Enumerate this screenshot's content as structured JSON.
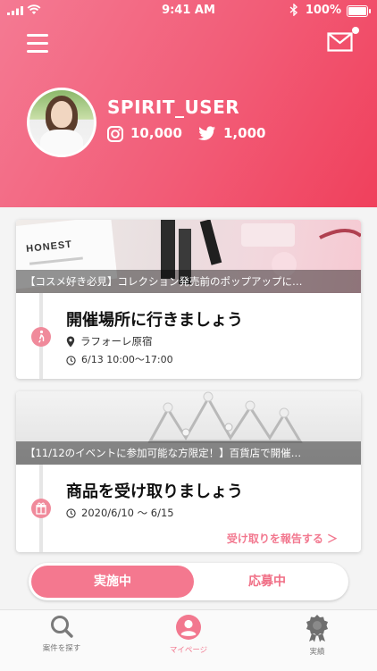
{
  "status_bar": {
    "time": "9:41 AM",
    "battery": "100%"
  },
  "profile": {
    "username": "SPIRIT_USER",
    "instagram_followers": "10,000",
    "twitter_followers": "1,000"
  },
  "events": [
    {
      "banner_caption": "【コスメ好き必見】コレクション発売前のポップアップに…",
      "title": "開催場所に行きましょう",
      "location": "ラフォーレ原宿",
      "datetime": "6/13 10:00〜17:00",
      "step_icon": "walking-person-icon"
    },
    {
      "banner_caption": "【11/12のイベントに参加可能な方限定！】百貨店で開催…",
      "title": "商品を受け取りましょう",
      "period": "2020/6/10 〜 6/15",
      "report_link": "受け取りを報告する ＞",
      "step_icon": "gift-icon"
    }
  ],
  "tabs": {
    "active": "実施中",
    "inactive": "応募中"
  },
  "bottom_nav": [
    {
      "label": "案件を探す",
      "icon": "search-icon"
    },
    {
      "label": "マイページ",
      "icon": "user-icon"
    },
    {
      "label": "実績",
      "icon": "badge-icon"
    }
  ],
  "colors": {
    "accent": "#f4788f",
    "header_start": "#f47a93",
    "header_end": "#f0405c"
  }
}
